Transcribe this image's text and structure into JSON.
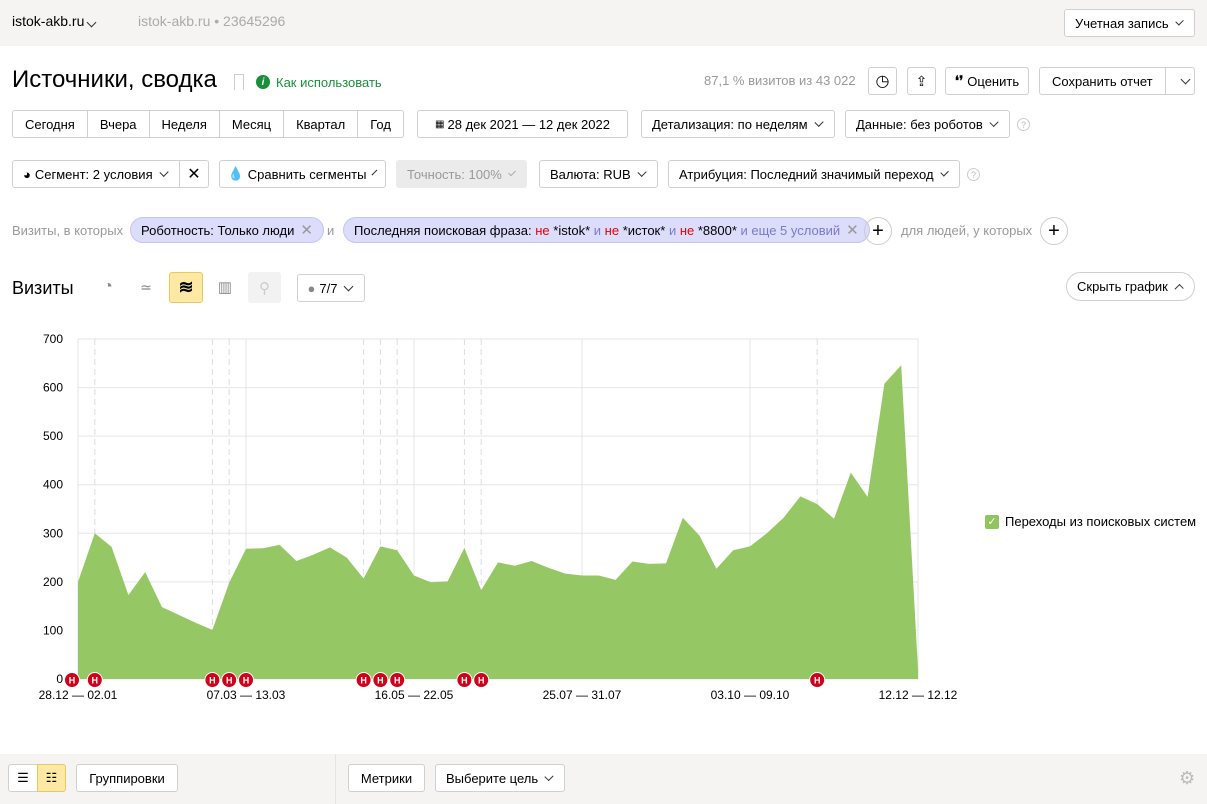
{
  "topbar": {
    "site": "istok-akb.ru",
    "counter": "istok-akb.ru • 23645296",
    "account": "Учетная запись"
  },
  "header": {
    "title": "Источники, сводка",
    "how_to": "Как использовать",
    "sample": "87,1 % визитов из 43 022",
    "rate": "Оценить",
    "save": "Сохранить отчет"
  },
  "periods": [
    "Сегодня",
    "Вчера",
    "Неделя",
    "Месяц",
    "Квартал",
    "Год"
  ],
  "date_range": "28 дек 2021 — 12 дек 2022",
  "detail": "Детализация: по неделям",
  "data_filter": "Данные: без роботов",
  "segment": "Сегмент: 2 условия",
  "compare": "Сравнить сегменты",
  "accuracy": "Точность: 100%",
  "currency": "Валюта: RUB",
  "attribution": "Атрибуция: Последний значимый переход",
  "filters": {
    "prefix": "Визиты, в которых",
    "chip1": "Роботность: Только люди",
    "and": "и",
    "chip2_label": "Последняя поисковая фраза:",
    "not1": "не",
    "v1": "*istok*",
    "and1": "и",
    "not2": "не",
    "v2": "*исток*",
    "and2": "и",
    "not3": "не",
    "v3": "*8800*",
    "more": "и еще 5 условий",
    "people": "для людей, у которых"
  },
  "chart_toolbar": {
    "title": "Визиты",
    "notes": "7/7",
    "hide": "Скрыть график"
  },
  "legend": {
    "label": "Переходы из поисковых систем",
    "color": "#8fc55d",
    "checked": true
  },
  "bottom": {
    "groupings": "Группировки",
    "metrics": "Метрики",
    "goal": "Выберите цель"
  },
  "chart_data": {
    "type": "area",
    "ylim": [
      0,
      700
    ],
    "yticks": [
      0,
      100,
      200,
      300,
      400,
      500,
      600,
      700
    ],
    "x_ticks": [
      {
        "index": 0,
        "label": "28.12 — 02.01"
      },
      {
        "index": 10,
        "label": "07.03 — 13.03"
      },
      {
        "index": 20,
        "label": "16.05 — 22.05"
      },
      {
        "index": 30,
        "label": "25.07 — 31.07"
      },
      {
        "index": 40,
        "label": "03.10 — 09.10"
      },
      {
        "index": 50,
        "label": "12.12 — 12.12"
      }
    ],
    "series": [
      {
        "values": [
          200,
          300,
          272,
          173,
          220,
          148,
          132,
          116,
          101,
          198,
          268,
          269,
          276,
          243,
          256,
          271,
          250,
          207,
          273,
          265,
          213,
          199,
          201,
          270,
          183,
          240,
          233,
          243,
          229,
          217,
          213,
          213,
          204,
          242,
          237,
          238,
          332,
          295,
          227,
          265,
          273,
          300,
          332,
          376,
          360,
          330,
          425,
          375,
          608,
          646,
          20
        ],
        "color": "#8fc55d"
      }
    ],
    "annotations": {
      "label": "Н",
      "indices": [
        0,
        1,
        8,
        9,
        10,
        17,
        18,
        19,
        23,
        24,
        44
      ],
      "color": "#d0021b"
    },
    "grid": true
  }
}
